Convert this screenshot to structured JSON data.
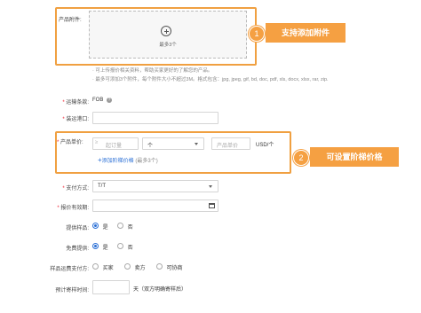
{
  "attachment": {
    "label": "产品附件:",
    "max_text": "最多3个",
    "notes": [
      "· 可上传报价相关资料，帮助买家更好的了解您的产品。",
      "· 最多可添加3个附件，每个附件大小不超过3M。格式包含：jpg, jpeg, gif, bd, doc, pdf, xls, docx, xlsx, rar, zip."
    ]
  },
  "callouts": [
    {
      "num": "1",
      "text": "支持添加附件"
    },
    {
      "num": "2",
      "text": "可设置阶梯价格"
    }
  ],
  "shipping_terms": {
    "label": "运输条款:",
    "value": "FOB"
  },
  "port": {
    "label": "装运港口:",
    "value": ""
  },
  "unit_price": {
    "label": "产品单价:",
    "start_placeholder": "起订量",
    "unit_value": "个",
    "price_placeholder": "产品单价",
    "currency": "USD/个",
    "add_tier": "添加阶梯价格",
    "add_tier_note": "(最多3个)"
  },
  "payment": {
    "label": "支付方式:",
    "value": "T/T"
  },
  "validity": {
    "label": "报价有效期:",
    "value": ""
  },
  "sample": {
    "label": "提供样品:",
    "options": [
      "是",
      "否"
    ],
    "selected": 0
  },
  "free_sample": {
    "label": "免费提供:",
    "options": [
      "是",
      "否"
    ],
    "selected": 0
  },
  "sample_freight": {
    "label": "样品运费支付方:",
    "options": [
      "买家",
      "卖方",
      "可协商"
    ],
    "selected": -1
  },
  "delivery": {
    "label": "预计寄样时间:",
    "value": "",
    "suffix": "天（双方明确寄样后）"
  },
  "colors": {
    "accent": "#f5a042",
    "link": "#2a6fd6",
    "required": "#e23333"
  }
}
